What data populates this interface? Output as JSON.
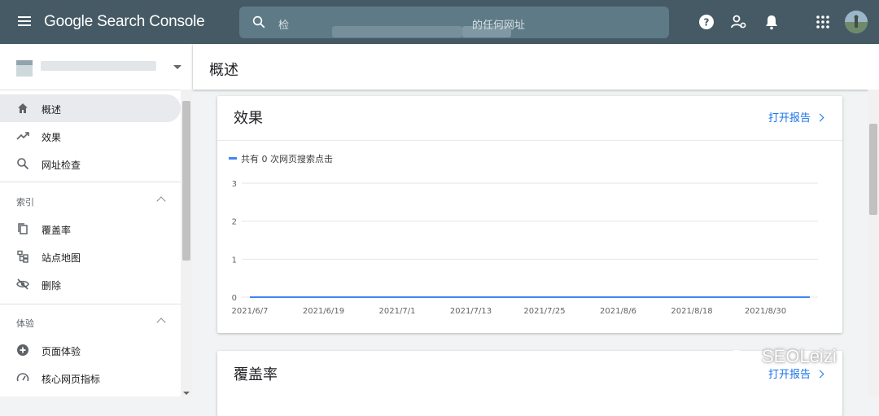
{
  "app": {
    "title": "Google Search Console"
  },
  "search": {
    "placeholder_prefix": "检",
    "placeholder_suffix": "的任何网址"
  },
  "header": {
    "title": "概述"
  },
  "sidebar": {
    "items": [
      {
        "label": "概述",
        "icon": "home-icon",
        "active": true
      },
      {
        "label": "效果",
        "icon": "trending-up-icon"
      },
      {
        "label": "网址检查",
        "icon": "search-icon"
      }
    ],
    "sections": [
      {
        "label": "索引",
        "items": [
          {
            "label": "覆盖率",
            "icon": "copy-icon"
          },
          {
            "label": "站点地图",
            "icon": "sitemap-icon"
          },
          {
            "label": "删除",
            "icon": "eye-off-icon"
          }
        ]
      },
      {
        "label": "体验",
        "items": [
          {
            "label": "页面体验",
            "icon": "add-circle-icon"
          },
          {
            "label": "核心网页指标",
            "icon": "speed-icon"
          }
        ]
      }
    ]
  },
  "cards": {
    "performance": {
      "title": "效果",
      "link": "打开报告"
    },
    "coverage": {
      "title": "覆盖率",
      "link": "打开报告"
    }
  },
  "chart_data": {
    "type": "line",
    "series": [
      {
        "name": "共有 0 次网页搜索点击",
        "color": "#4285f4",
        "values": [
          0,
          0
        ]
      }
    ],
    "x": [
      "2021/6/7",
      "2021/6/19",
      "2021/7/1",
      "2021/7/13",
      "2021/7/25",
      "2021/8/6",
      "2021/8/18",
      "2021/8/30"
    ],
    "yticks": [
      0,
      1,
      2,
      3
    ],
    "ylim": [
      0,
      3
    ],
    "grid": true,
    "legend_position": "top-left"
  },
  "watermark": "SEOLeizi",
  "colors": {
    "topbar": "#455a64",
    "accent": "#1a73e8",
    "series": "#4285f4"
  }
}
